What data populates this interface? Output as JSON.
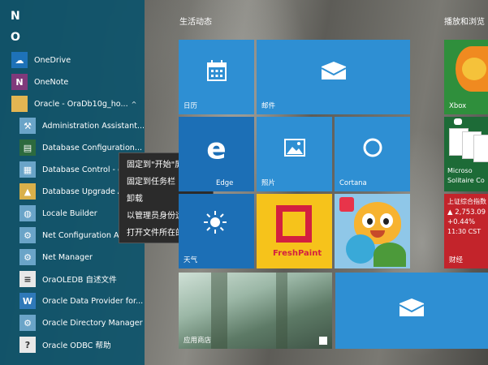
{
  "start_list": {
    "letters": [
      "N",
      "O"
    ],
    "apps": [
      {
        "label": "OneDrive",
        "icon": "onedrive-icon"
      },
      {
        "label": "OneNote",
        "icon": "onenote-icon"
      },
      {
        "label": "Oracle - OraDb10g_ho...",
        "icon": "folder-icon",
        "chevron": "^"
      },
      {
        "label": "Administration Assistant...",
        "icon": "admin-assistant-icon"
      },
      {
        "label": "Database Configuration...",
        "icon": "db-config-icon"
      },
      {
        "label": "Database Control - or",
        "icon": "db-control-icon"
      },
      {
        "label": "Database Upgrade As",
        "icon": "db-upgrade-icon"
      },
      {
        "label": "Locale Builder",
        "icon": "locale-builder-icon"
      },
      {
        "label": "Net Configuration Ass",
        "icon": "net-config-icon"
      },
      {
        "label": "Net Manager",
        "icon": "net-manager-icon"
      },
      {
        "label": "OraOLEDB 自述文件",
        "icon": "readme-icon"
      },
      {
        "label": "Oracle Data Provider for...",
        "icon": "word-doc-icon"
      },
      {
        "label": "Oracle Directory Manager",
        "icon": "directory-manager-icon"
      },
      {
        "label": "Oracle ODBC 帮助",
        "icon": "odbc-help-icon"
      }
    ]
  },
  "context_menu": {
    "items": [
      "固定到\"开始\"屏幕",
      "固定到任务栏",
      "卸载",
      "以管理员身份运行",
      "打开文件所在的位置"
    ]
  },
  "groups": {
    "life": "生活动态",
    "play": "播放和浏览"
  },
  "tiles": {
    "calendar": "日历",
    "mail": "邮件",
    "edge": "Edge",
    "photos": "照片",
    "cortana": "Cortana",
    "weather": "天气",
    "store": "应用商店",
    "xbox": "Xbox",
    "solitaire_top": "Microso",
    "solitaire_bottom": "Solitaire Co",
    "stock_name": "上证综合指数",
    "stock_value": "▲ 2,753.09",
    "stock_change": "+0.44%",
    "stock_time": "11:30 CST",
    "finance": "财经",
    "freshpaint": "FreshPaint"
  },
  "colors": {
    "tile_blue": "#2e8fd3",
    "applist_bg": "#0e546c",
    "finance_red": "#c3242b"
  }
}
